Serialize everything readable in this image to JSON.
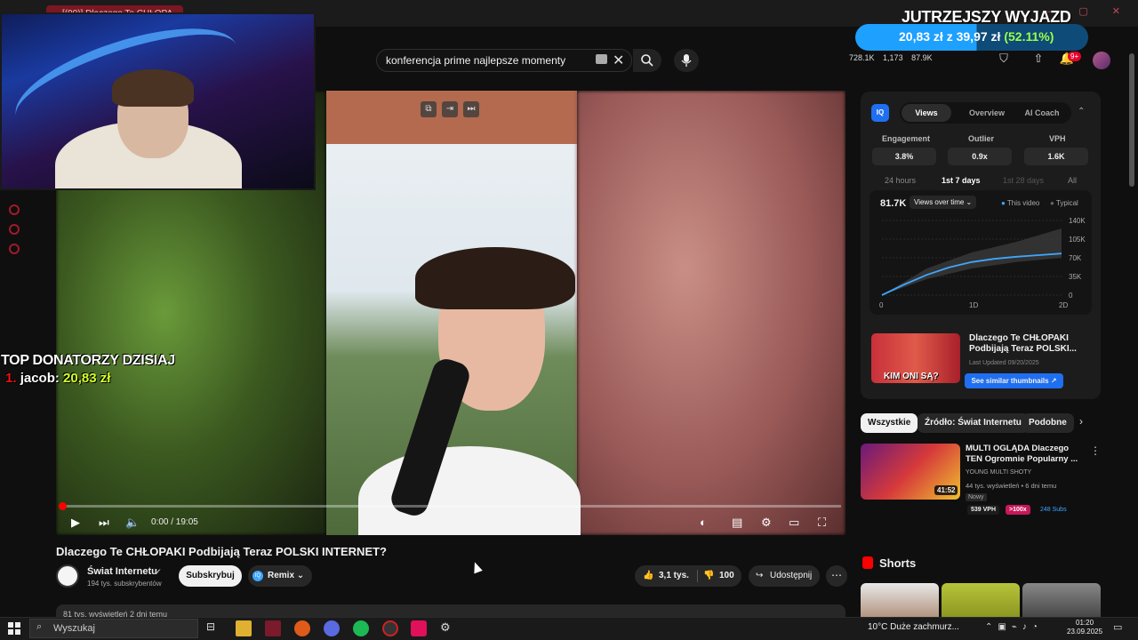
{
  "browser": {
    "tab_title": "[(90)] Dlaczego Te CHŁOPA..."
  },
  "search": {
    "query": "konferencja prime najlepsze momenty"
  },
  "header_stats": {
    "views": "728.1K",
    "likes": "1,173",
    "subs": "87.9K",
    "notifications": "9+"
  },
  "overlay": {
    "goal_title": "JUTRZEJSZY WYJAZD",
    "goal_current": "20,83 zł",
    "goal_sep": "z",
    "goal_target": "39,97 zł",
    "goal_percent": "(52.11%)",
    "goal_progress": 0.5211,
    "donors_title": "TOP DONATORZY DZISIAJ",
    "donor_rank": "1.",
    "donor_name": "jacob:",
    "donor_amount": "20,83 zł"
  },
  "player": {
    "time": "0:00 / 19:05",
    "progress": 0.0
  },
  "video": {
    "title": "Dlaczego Te CHŁOPAKI Podbijają Teraz POLSKI INTERNET?",
    "channel_name": "Świat Internetu",
    "channel_subs": "194 tys. subskrybentów",
    "subscribe_label": "Subskrybuj",
    "remix_label": "Remix",
    "likes": "3,1 tys.",
    "dislikes": "100",
    "share_label": "Udostępnij",
    "desc_meta": "81 tys. wyświetleń  2 dni temu"
  },
  "vidiq": {
    "logo": "IQ",
    "tabs": [
      "Views",
      "Overview",
      "AI Coach"
    ],
    "stats": [
      {
        "label": "Engagement",
        "value": "3.8%"
      },
      {
        "label": "Outlier",
        "value": "0.9x"
      },
      {
        "label": "VPH",
        "value": "1.6K"
      }
    ],
    "ranges": [
      "24 hours",
      "1st 7 days",
      "1st 28 days",
      "All"
    ],
    "chart_total": "81.7K",
    "chart_selector": "Views over time",
    "legend_this": "This video",
    "legend_typical": "Typical",
    "related_thumb_text": "KIM ONI SĄ?",
    "related_title": "Dlaczego Te CHŁOPAKI Podbijają Teraz POLSKI...",
    "related_date": "Last Updated 09/20/2025",
    "similar_btn": "See similar thumbnails ↗"
  },
  "chart_data": {
    "type": "area",
    "x_ticks": [
      "0",
      "1D",
      "2D"
    ],
    "y_ticks": [
      "140K",
      "105K",
      "70K",
      "35K",
      "0"
    ],
    "ylim": [
      0,
      140000
    ],
    "series": [
      {
        "name": "This video",
        "x": [
          0,
          0.25,
          0.5,
          0.75,
          1.0,
          1.25,
          1.5,
          1.75,
          2.0
        ],
        "values": [
          0,
          20000,
          38000,
          52000,
          62000,
          68000,
          72000,
          75000,
          78000
        ]
      },
      {
        "name": "Typical",
        "x": [
          0,
          0.5,
          1.0,
          1.5,
          2.0
        ],
        "values_low": [
          0,
          30000,
          50000,
          62000,
          70000
        ],
        "values_high": [
          0,
          50000,
          80000,
          100000,
          125000
        ]
      }
    ]
  },
  "chips": [
    "Wszystkie",
    "Źródło: Świat Internetu",
    "Podobne"
  ],
  "recommendation": {
    "title": "MULTI OGLĄDA Dlaczego TEN Ogromnie Popularny ...",
    "channel": "YOUNG MULTI SHOTY",
    "meta": "44 tys. wyświetleń • 6 dni temu",
    "new_badge": "Nowy",
    "vph": "539 VPH",
    "multiplier": ">100x",
    "subs": "248 Subs",
    "duration": "41:52"
  },
  "shorts": {
    "title": "Shorts"
  },
  "taskbar": {
    "search_placeholder": "Wyszukaj",
    "weather": "10°C  Duże zachmurz...",
    "time": "01:20",
    "date": "23.09.2025"
  },
  "colors": {
    "youtube_red": "#ff0000",
    "vidiq_blue": "#1f6ff0",
    "goal_bar": "#1ea0ff",
    "donor_amount": "#d7ff27"
  }
}
